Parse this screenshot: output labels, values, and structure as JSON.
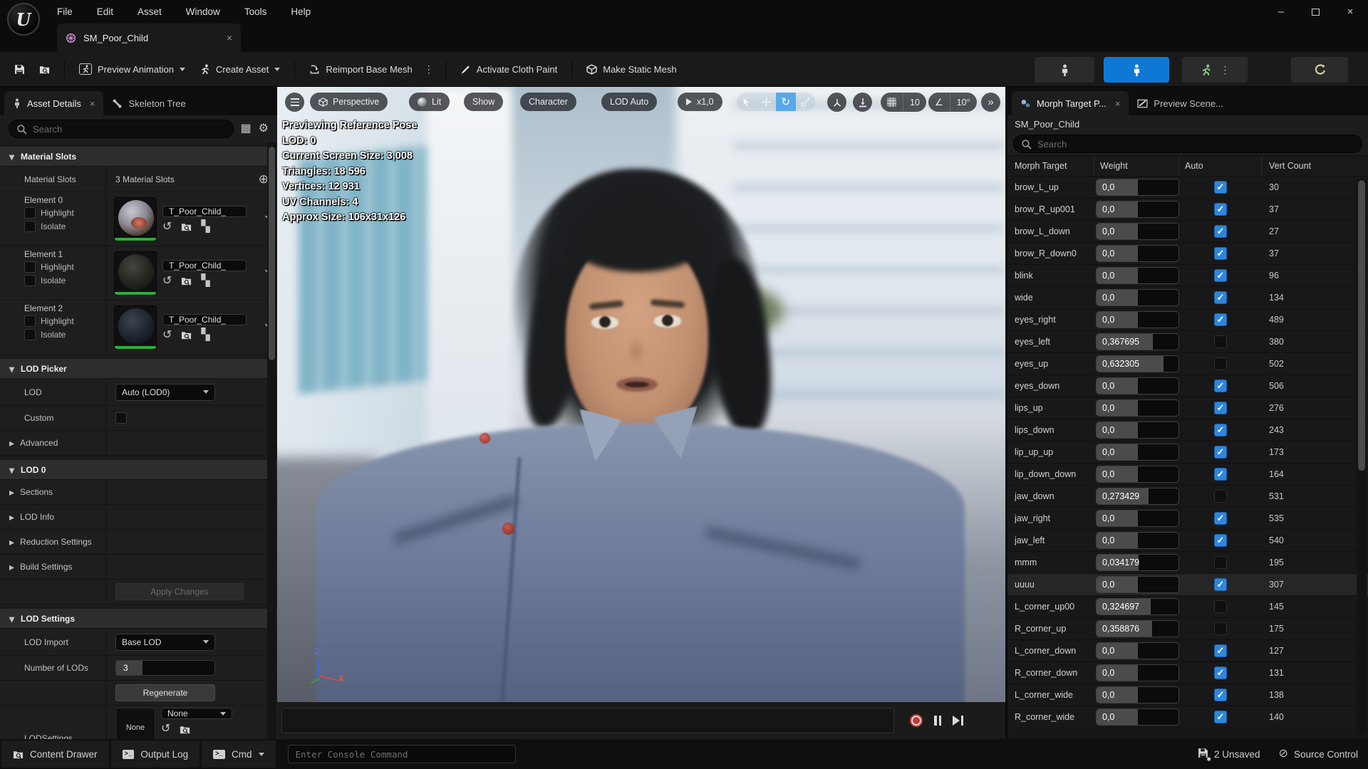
{
  "icons": {
    "collapse": "▾",
    "expand": "▸",
    "gear": "⚙",
    "view_options": "▦",
    "add": "⊕",
    "checker": "▚",
    "reset": "↶",
    "use_asset": "↺",
    "dots": "⋮",
    "more": "»",
    "angle": "∠",
    "slash_circle": "⊘",
    "close": "×",
    "min": "–",
    "rotate": "↻",
    "logo": "U"
  },
  "menu": {
    "items": [
      "File",
      "Edit",
      "Asset",
      "Window",
      "Tools",
      "Help"
    ]
  },
  "editor_tab": {
    "label": "SM_Poor_Child"
  },
  "toolbar": {
    "preview_animation": "Preview Animation",
    "create_asset": "Create Asset",
    "reimport_base_mesh": "Reimport Base Mesh",
    "activate_cloth_paint": "Activate Cloth Paint",
    "make_static_mesh": "Make Static Mesh"
  },
  "left_panel": {
    "tabs": [
      {
        "label": "Asset Details"
      },
      {
        "label": "Skeleton Tree"
      }
    ],
    "search_placeholder": "Search",
    "material_slots": {
      "header": "Material Slots",
      "row_label": "Material Slots",
      "count_label": "3 Material Slots",
      "elements": [
        {
          "name": "Element 0",
          "highlight": "Highlight",
          "isolate": "Isolate",
          "material": "T_Poor_Child_"
        },
        {
          "name": "Element 1",
          "highlight": "Highlight",
          "isolate": "Isolate",
          "material": "T_Poor_Child_"
        },
        {
          "name": "Element 2",
          "highlight": "Highlight",
          "isolate": "Isolate",
          "material": "T_Poor_Child_"
        }
      ]
    },
    "lod_picker": {
      "header": "LOD Picker",
      "lod_label": "LOD",
      "lod_value": "Auto (LOD0)",
      "custom_label": "Custom",
      "advanced_label": "Advanced"
    },
    "lod0": {
      "header": "LOD 0",
      "items": [
        "Sections",
        "LOD Info",
        "Reduction Settings",
        "Build Settings"
      ],
      "apply_label": "Apply Changes"
    },
    "lod_settings": {
      "header": "LOD Settings",
      "import_label": "LOD Import",
      "import_value": "Base LOD",
      "num_label": "Number of LODs",
      "num_value": "3",
      "regenerate_label": "Regenerate",
      "lodsettings_label": "LODSettings",
      "thumb_label": "None",
      "select_value": "None"
    }
  },
  "viewport": {
    "pills": {
      "perspective": "Perspective",
      "lit": "Lit",
      "show": "Show",
      "character": "Character",
      "lod": "LOD Auto",
      "speed": "x1,0"
    },
    "snap_grid": "10",
    "snap_angle": "10°",
    "stats": [
      "Previewing Reference Pose",
      "LOD: 0",
      "Current Screen Size: 3,008",
      "Triangles: 18 596",
      "Vertices: 12 931",
      "UV Channels: 4",
      "Approx Size: 106x31x126"
    ],
    "axis": {
      "z": "Z",
      "x": "X"
    }
  },
  "right_panel": {
    "tabs": [
      {
        "label": "Morph Target P..."
      },
      {
        "label": "Preview Scene..."
      }
    ],
    "asset_name": "SM_Poor_Child",
    "search_placeholder": "Search",
    "columns": [
      "Morph Target",
      "Weight",
      "Auto",
      "Vert Count"
    ],
    "rows": [
      {
        "name": "brow_L_up",
        "weight": "0,0",
        "auto": true,
        "verts": "30"
      },
      {
        "name": "brow_R_up001",
        "weight": "0,0",
        "auto": true,
        "verts": "37"
      },
      {
        "name": "brow_L_down",
        "weight": "0,0",
        "auto": true,
        "verts": "27"
      },
      {
        "name": "brow_R_down0",
        "weight": "0,0",
        "auto": true,
        "verts": "37"
      },
      {
        "name": "blink",
        "weight": "0,0",
        "auto": true,
        "verts": "96"
      },
      {
        "name": "wide",
        "weight": "0,0",
        "auto": true,
        "verts": "134"
      },
      {
        "name": "eyes_right",
        "weight": "0,0",
        "auto": true,
        "verts": "489"
      },
      {
        "name": "eyes_left",
        "weight": "0,367695",
        "auto": false,
        "verts": "380"
      },
      {
        "name": "eyes_up",
        "weight": "0,632305",
        "auto": false,
        "verts": "502"
      },
      {
        "name": "eyes_down",
        "weight": "0,0",
        "auto": true,
        "verts": "506"
      },
      {
        "name": "lips_up",
        "weight": "0,0",
        "auto": true,
        "verts": "276"
      },
      {
        "name": "lips_down",
        "weight": "0,0",
        "auto": true,
        "verts": "243"
      },
      {
        "name": "lip_up_up",
        "weight": "0,0",
        "auto": true,
        "verts": "173"
      },
      {
        "name": "lip_down_down",
        "weight": "0,0",
        "auto": true,
        "verts": "164"
      },
      {
        "name": "jaw_down",
        "weight": "0,273429",
        "auto": false,
        "verts": "531"
      },
      {
        "name": "jaw_right",
        "weight": "0,0",
        "auto": true,
        "verts": "535"
      },
      {
        "name": "jaw_left",
        "weight": "0,0",
        "auto": true,
        "verts": "540"
      },
      {
        "name": "mmm",
        "weight": "0,034179",
        "auto": false,
        "verts": "195"
      },
      {
        "name": "uuuu",
        "weight": "0,0",
        "auto": true,
        "verts": "307",
        "highlighted": true
      },
      {
        "name": "L_corner_up00",
        "weight": "0,324697",
        "auto": false,
        "verts": "145"
      },
      {
        "name": "R_corner_up",
        "weight": "0,358876",
        "auto": false,
        "verts": "175"
      },
      {
        "name": "L_corner_down",
        "weight": "0,0",
        "auto": true,
        "verts": "127"
      },
      {
        "name": "R_corner_down",
        "weight": "0,0",
        "auto": true,
        "verts": "131"
      },
      {
        "name": "L_corner_wide",
        "weight": "0,0",
        "auto": true,
        "verts": "138"
      },
      {
        "name": "R_corner_wide",
        "weight": "0,0",
        "auto": true,
        "verts": "140"
      }
    ]
  },
  "status_bar": {
    "content_drawer": "Content Drawer",
    "output_log": "Output Log",
    "cmd": "Cmd",
    "console_placeholder": "Enter Console Command",
    "unsaved": "2 Unsaved",
    "source_control": "Source Control"
  },
  "colors": {
    "accent_blue": "#0f78d7",
    "check_blue": "#2f86dd",
    "thumb_green": "#2fae3e",
    "record_red": "#c33a35",
    "rotate_active": "#57a9ea"
  }
}
